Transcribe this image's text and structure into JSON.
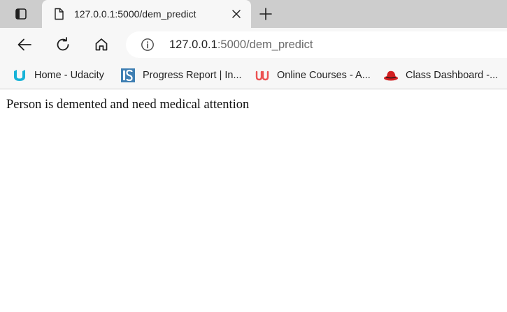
{
  "browser": {
    "tab": {
      "title": "127.0.0.1:5000/dem_predict",
      "icons": {
        "favicon": "page-icon",
        "close": "close-icon"
      }
    },
    "icons": {
      "tab_actions": "tab-actions-icon",
      "new_tab": "plus-icon"
    },
    "toolbar": {
      "icons": {
        "back": "back-arrow-icon",
        "reload": "reload-icon",
        "home": "home-icon",
        "site_info": "info-icon"
      },
      "url_host": "127.0.0.1",
      "url_path": ":5000/dem_predict"
    },
    "bookmarks": [
      {
        "label": "Home - Udacity",
        "icon": "udacity-logo-icon"
      },
      {
        "label": "Progress Report | In...",
        "icon": "infosys-logo-icon"
      },
      {
        "label": "Online Courses - A...",
        "icon": "udemy-logo-icon"
      },
      {
        "label": "Class Dashboard -...",
        "icon": "redhat-logo-icon"
      }
    ],
    "colors": {
      "tabstrip_bg": "#cdcdcd",
      "toolbar_bg": "#f7f7f7",
      "page_bg": "#ffffff"
    }
  },
  "page": {
    "message": "Person is demented and need medical attention"
  }
}
